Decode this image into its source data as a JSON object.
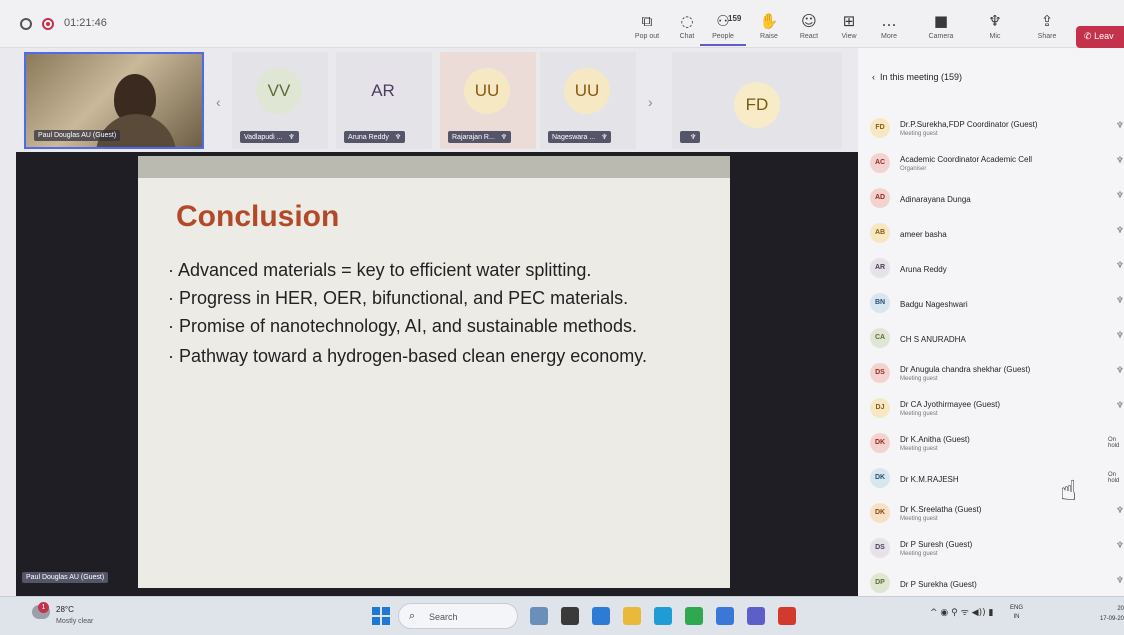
{
  "meeting": {
    "timer": "01:21:46"
  },
  "toolbar": {
    "items": [
      {
        "label": "Pop out",
        "icon": "popout-icon",
        "glyph": "⧉"
      },
      {
        "label": "Chat",
        "icon": "chat-icon",
        "glyph": "◌"
      },
      {
        "label": "People",
        "icon": "people-icon",
        "glyph": "⚇",
        "count": "159"
      },
      {
        "label": "Raise",
        "icon": "raise-hand-icon",
        "glyph": "✋"
      },
      {
        "label": "React",
        "icon": "react-icon",
        "glyph": "☺"
      },
      {
        "label": "View",
        "icon": "view-icon",
        "glyph": "⊞"
      },
      {
        "label": "More",
        "icon": "more-icon",
        "glyph": "…"
      },
      {
        "label": "Camera",
        "icon": "camera-icon",
        "glyph": "■"
      },
      {
        "label": "Mic",
        "icon": "mic-icon",
        "glyph": "♆"
      },
      {
        "label": "Share",
        "icon": "share-icon",
        "glyph": "⇪"
      }
    ],
    "leave_label": "Leav"
  },
  "self_tile": {
    "name": "Paul Douglas AU (Guest)"
  },
  "tiles": [
    {
      "initials": "VV",
      "name": "Vadlapudi ...",
      "bg": "#e4e3e8",
      "avatar_bg": "#dfe6d3",
      "avatar_color": "#5e6b3a"
    },
    {
      "initials": "AR",
      "name": "Aruna Reddy",
      "bg": "#e4e3e8",
      "avatar_bg": "#e6e2ea",
      "avatar_color": "#4b3d5c"
    },
    {
      "initials": "UU",
      "name": "Rajarajan R...",
      "bg": "#ecdcd8",
      "avatar_bg": "#f7e8c4",
      "avatar_color": "#8a5a12"
    },
    {
      "initials": "UU",
      "name": "Nageswara ...",
      "bg": "#e4e3e8",
      "avatar_bg": "#f7e8c4",
      "avatar_color": "#8a5a12"
    },
    {
      "initials": "FD",
      "name": "",
      "bg": "#e4e3e8",
      "avatar_bg": "#f7ebc8",
      "avatar_color": "#7a5a10"
    }
  ],
  "slide": {
    "title": "Conclusion",
    "points": [
      "Advanced materials = key to efficient water splitting.",
      "Progress in HER, OER, bifunctional, and PEC materials.",
      "Promise of nanotechnology, AI, and sustainable methods.",
      "Pathway toward a hydrogen-based clean energy economy."
    ]
  },
  "presenter_label": "Paul Douglas AU (Guest)",
  "panel": {
    "header": "In this meeting (159)",
    "participants": [
      {
        "initials": "FD",
        "name": "Dr.P.Surekha,FDP Coordinator (Guest)",
        "sub": "Meeting guest",
        "status": "",
        "bg": "#f7e8c4",
        "fg": "#8a5a12"
      },
      {
        "initials": "AC",
        "name": "Academic Coordinator Academic Cell",
        "sub": "Organiser",
        "status": "",
        "bg": "#f3d3d0",
        "fg": "#9a2a1e"
      },
      {
        "initials": "AD",
        "name": "Adinarayana Dunga",
        "sub": "",
        "status": "",
        "bg": "#f3d3d0",
        "fg": "#9a2a1e"
      },
      {
        "initials": "AB",
        "name": "ameer basha",
        "sub": "",
        "status": "",
        "bg": "#f7e8c4",
        "fg": "#8a5a12"
      },
      {
        "initials": "AR",
        "name": "Aruna Reddy",
        "sub": "",
        "status": "",
        "bg": "#e6e2ea",
        "fg": "#4b3d5c"
      },
      {
        "initials": "BN",
        "name": "Badgu Nageshwari",
        "sub": "",
        "status": "",
        "bg": "#d8e6f0",
        "fg": "#2a5070"
      },
      {
        "initials": "CA",
        "name": "CH S ANURADHA",
        "sub": "",
        "status": "",
        "bg": "#dfe6d3",
        "fg": "#5e6b3a"
      },
      {
        "initials": "DS",
        "name": "Dr Anugula chandra shekhar (Guest)",
        "sub": "Meeting guest",
        "status": "",
        "bg": "#f3d3d0",
        "fg": "#9a2a1e"
      },
      {
        "initials": "DJ",
        "name": "Dr CA Jyothirmayee (Guest)",
        "sub": "Meeting guest",
        "status": "",
        "bg": "#f7e8c4",
        "fg": "#8a5a12"
      },
      {
        "initials": "DK",
        "name": "Dr K.Anitha (Guest)",
        "sub": "Meeting guest",
        "status": "On hold",
        "bg": "#f3d3d0",
        "fg": "#9a2a1e"
      },
      {
        "initials": "DK",
        "name": "Dr K.M.RAJESH",
        "sub": "",
        "status": "On hold",
        "bg": "#d8e6f0",
        "fg": "#2a5070"
      },
      {
        "initials": "DK",
        "name": "Dr K.Sreelatha (Guest)",
        "sub": "Meeting guest",
        "status": "",
        "bg": "#f7e0c4",
        "fg": "#8a4a12"
      },
      {
        "initials": "DS",
        "name": "Dr P Suresh (Guest)",
        "sub": "Meeting guest",
        "status": "",
        "bg": "#e6e2ea",
        "fg": "#4b3d5c"
      },
      {
        "initials": "DP",
        "name": "Dr P Surekha (Guest)",
        "sub": "",
        "status": "",
        "bg": "#dfe6d3",
        "fg": "#5e6b3a"
      }
    ]
  },
  "taskbar": {
    "weather_temp": "28°C",
    "weather_desc": "Mostly clear",
    "weather_badge": "1",
    "search_placeholder": "Search",
    "lang_1": "ENG",
    "lang_2": "IN",
    "clock_1": "20",
    "clock_2": "17-09-20",
    "apps": [
      {
        "name": "widgets-app-icon",
        "color": "#6a8fb8"
      },
      {
        "name": "taskview-app-icon",
        "color": "#3a3a3a"
      },
      {
        "name": "edge-beta-app-icon",
        "color": "#2e7bd6"
      },
      {
        "name": "file-explorer-app-icon",
        "color": "#e8b93a"
      },
      {
        "name": "edge-app-icon",
        "color": "#1f9bd6"
      },
      {
        "name": "store-app-icon",
        "color": "#2fa84f"
      },
      {
        "name": "chrome-app-icon",
        "color": "#3a78d8"
      },
      {
        "name": "teams-app-icon",
        "color": "#5b5fc7"
      },
      {
        "name": "pdf-app-icon",
        "color": "#d23a2e"
      }
    ]
  }
}
